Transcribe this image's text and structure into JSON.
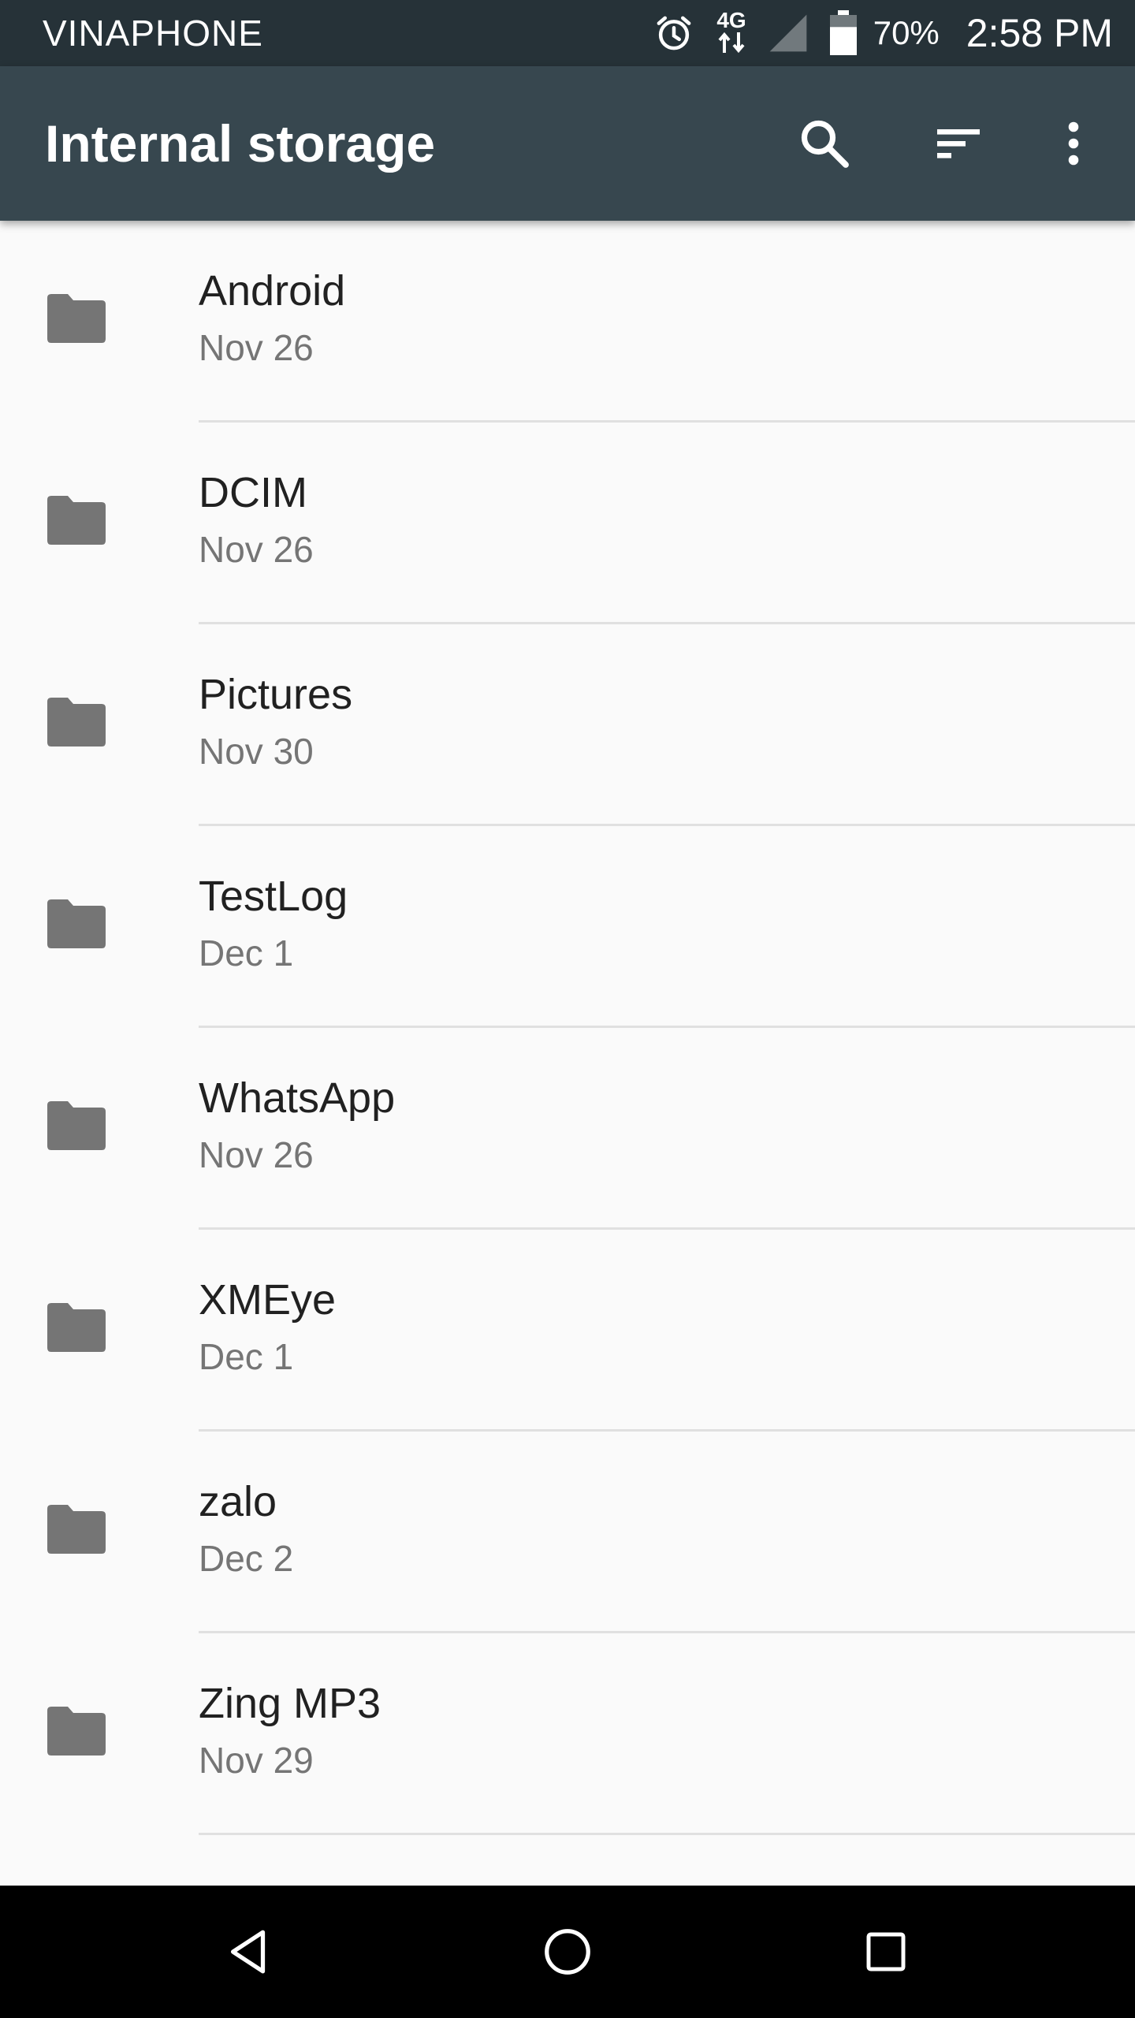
{
  "status_bar": {
    "carrier": "VINAPHONE",
    "network": "4G",
    "battery_percent": "70%",
    "battery_level": 0.7,
    "time": "2:58 PM",
    "icons": [
      "alarm-icon",
      "network-4g-icon",
      "signal-icon",
      "battery-icon"
    ]
  },
  "app_bar": {
    "title": "Internal storage",
    "actions": [
      "search-icon",
      "sort-icon",
      "more-vert-icon"
    ]
  },
  "files": [
    {
      "name": "Android",
      "date": "Nov 26"
    },
    {
      "name": "DCIM",
      "date": "Nov 26"
    },
    {
      "name": "Pictures",
      "date": "Nov 30"
    },
    {
      "name": "TestLog",
      "date": "Dec 1"
    },
    {
      "name": "WhatsApp",
      "date": "Nov 26"
    },
    {
      "name": "XMEye",
      "date": "Dec 1"
    },
    {
      "name": "zalo",
      "date": "Dec 2"
    },
    {
      "name": "Zing MP3",
      "date": "Nov 29"
    }
  ],
  "nav_bar": {
    "buttons": [
      "back-icon",
      "home-icon",
      "recents-icon"
    ]
  },
  "colors": {
    "status_bar": "#263238",
    "app_bar": "#37474f",
    "background": "#fafafa",
    "folder_icon": "#757575",
    "primary_text": "#212121",
    "secondary_text": "#757575",
    "divider": "#e0e0e0",
    "nav_bar": "#000000"
  }
}
